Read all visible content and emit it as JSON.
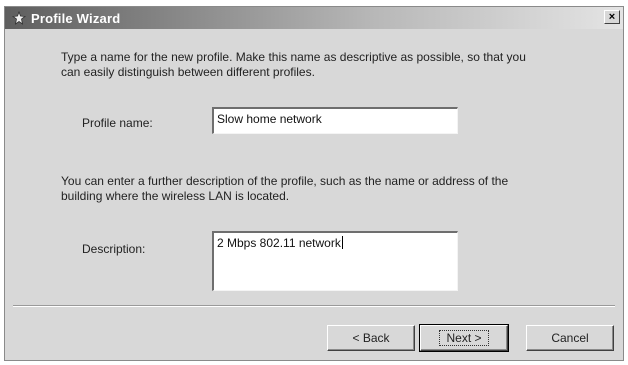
{
  "window": {
    "title": "Profile Wizard",
    "close_label": "×"
  },
  "intro": {
    "line1": "Type a name for the new profile. Make this name as descriptive as possible, so that you",
    "line2": "can easily distinguish between different profiles."
  },
  "profile_name": {
    "label": "Profile name:",
    "value": "Slow home network"
  },
  "description_help": {
    "line1": "You can enter a further description of the profile, such as the name or address of the",
    "line2": "building where the wireless LAN is located."
  },
  "description": {
    "label": "Description:",
    "value": "2 Mbps 802.11 network"
  },
  "buttons": {
    "back": "< Back",
    "next": "Next >",
    "cancel": "Cancel"
  },
  "icons": {
    "title_icon": "wizard-icon",
    "close_icon": "close-icon"
  }
}
